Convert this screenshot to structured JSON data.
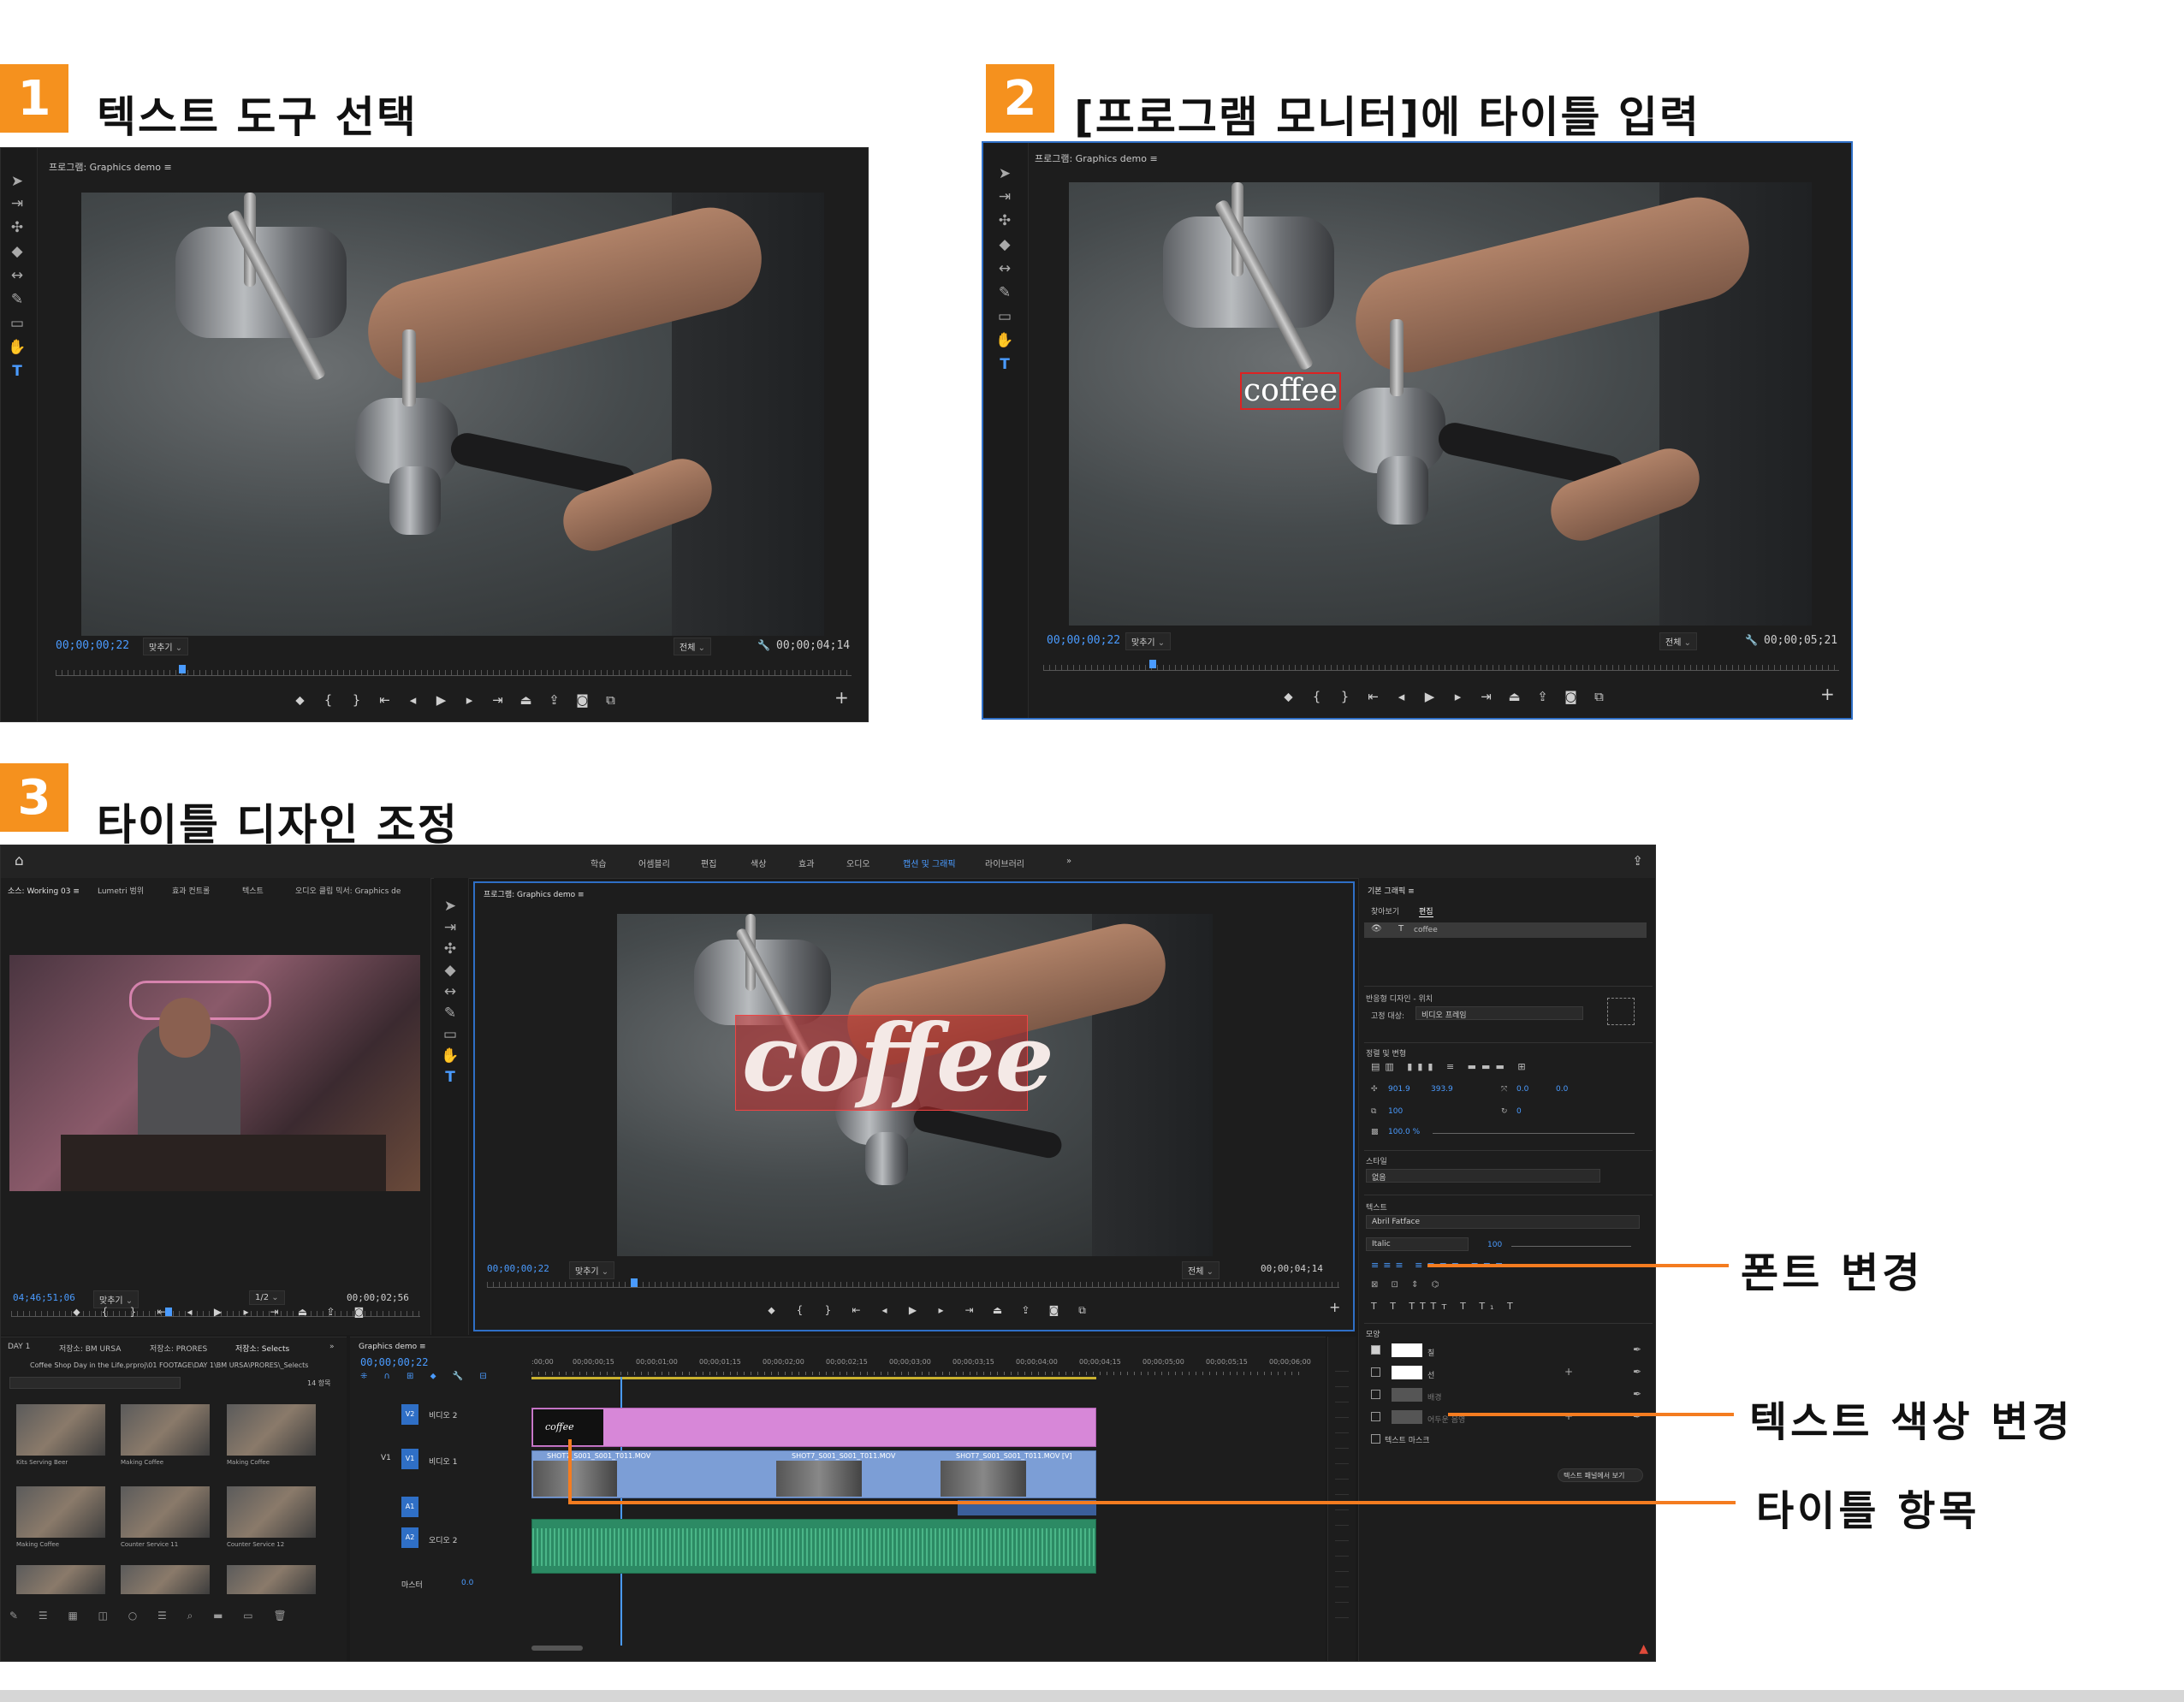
{
  "steps": [
    {
      "number": "1",
      "title": "텍스트 도구 선택"
    },
    {
      "number": "2",
      "title": "[프로그램 모니터]에 타이틀 입력"
    },
    {
      "number": "3",
      "title": "타이틀 디자인 조정"
    }
  ],
  "monitor1": {
    "tab": "프로그램: Graphics demo ≡",
    "timecode": "00;00;00;22",
    "fit": "맞추기",
    "quality": "전체",
    "duration": "00;00;04;14"
  },
  "monitor2": {
    "tab": "프로그램: Graphics demo ≡",
    "timecode": "00;00;00;22",
    "fit": "맞추기",
    "quality": "전체",
    "duration": "00;00;05;21",
    "title_text": "coffee"
  },
  "workspace": {
    "tabs": [
      "학습",
      "어셈블리",
      "편집",
      "색상",
      "효과",
      "오디오",
      "캡션 및 그래픽",
      "라이브러리",
      "»"
    ],
    "active_tab": "캡션 및 그래픽",
    "source_tabs": [
      "소스: Working 03 ≡",
      "Lumetri 범위",
      "효과 컨트롤",
      "텍스트",
      "오디오 클립 믹서: Graphics de"
    ],
    "source": {
      "timecode": "04;46;51;06",
      "fit": "맞추기",
      "ratio": "1/2",
      "duration": "00;00;02;56"
    },
    "program": {
      "tab": "프로그램: Graphics demo ≡",
      "timecode": "00;00;00;22",
      "fit": "맞추기",
      "quality": "전체",
      "duration": "00;00;04;14",
      "title_text": "coffee"
    },
    "project_tabs": [
      "DAY 1",
      "저장소: BM URSA",
      "저장소: PRORES",
      "저장소: Selects",
      "»"
    ],
    "project_path": "Coffee Shop Day in the Life.prproj\\01 FOOTAGE\\DAY 1\\BM URSA\\PRORES\\_Selects",
    "project_count": "14 항목",
    "thumbs": [
      "Kits Serving Beer",
      "Making Coffee",
      "Making Coffee",
      "Making Coffee",
      "Counter Service 11",
      "Counter Service 12"
    ],
    "timeline": {
      "tab": "Graphics demo ≡",
      "timecode": "00;00;00;22",
      "ruler": [
        ":00;00",
        "00;00;00;15",
        "00;00;01;00",
        "00;00;01;15",
        "00;00;02;00",
        "00;00;02;15",
        "00;00;03;00",
        "00;00;03;15",
        "00;00;04;00",
        "00;00;04;15",
        "00;00;05;00",
        "00;00;05;15",
        "00;00;06;00"
      ],
      "tracks": {
        "v2": "V2",
        "v1": "V1",
        "a1": "A1",
        "a2": "A2",
        "v2_name": "비디오 2",
        "v1_name": "비디오 1",
        "a2_name": "오디오 2",
        "master": "마스터",
        "master_val": "0.0"
      },
      "graphic_clip": "coffee",
      "clips": [
        "SHOT7_S001_S001_T011.MOV",
        "SHOT7_S001_S001_T011.MOV",
        "SHOT7_S001_S001_T011.MOV [V]"
      ]
    },
    "essential_graphics": {
      "title": "기본 그래픽 ≡",
      "tabs": [
        "찾아보기",
        "편집"
      ],
      "layer": "coffee",
      "responsive_label": "반응형 디자인 - 위치",
      "pin_label": "고정 대상:",
      "pin_value": "비디오 프레임",
      "align_label": "정렬 및 변형",
      "pos_x": "901.9",
      "pos_y": "393.9",
      "anchor_x": "0.0",
      "anchor_y": "0.0",
      "scale": "100",
      "rotation": "0",
      "opacity": "100.0 %",
      "style_label": "스타일",
      "style_value": "없음",
      "text_label": "텍스트",
      "font_value": "Abril Fatface",
      "font_style": "Italic",
      "font_size": "100",
      "appearance_label": "모양",
      "fill_label": "칠",
      "stroke_label": "선",
      "background_label": "배경",
      "shadow_label": "어두운 음영",
      "mask_label": "텍스트 마스크",
      "show_button": "텍스트 패널에서 보기"
    }
  },
  "callouts": {
    "font_change": "폰트 변경",
    "text_color_change": "텍스트 색상 변경",
    "title_item": "타이틀 항목"
  },
  "colors": {
    "accent": "#f5911e",
    "selection": "#2f6fc6",
    "playhead": "#4a9bff",
    "graphic_clip": "#d787d8",
    "video_clip": "#7c9ed6",
    "audio_clip": "#2c8a64"
  }
}
